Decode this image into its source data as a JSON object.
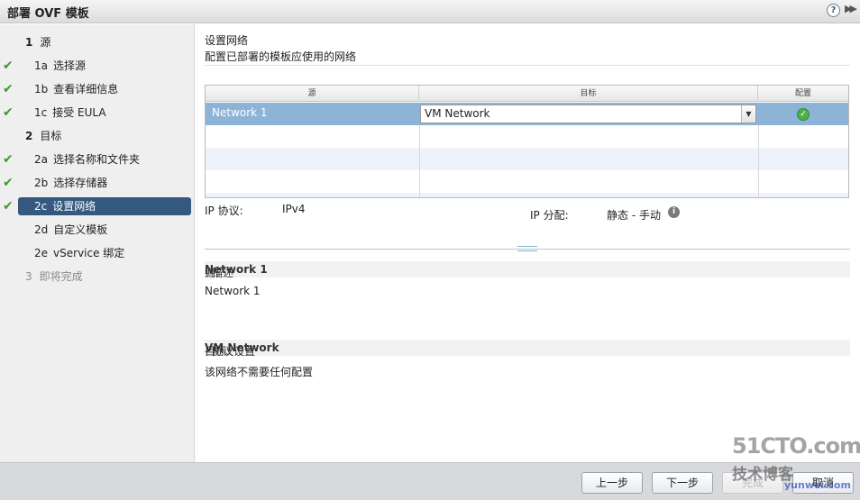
{
  "window": {
    "title": "部署 OVF 模板"
  },
  "nav": {
    "steps": [
      {
        "num": "1",
        "label": "源"
      },
      {
        "num": "1a",
        "label": "选择源"
      },
      {
        "num": "1b",
        "label": "查看详细信息"
      },
      {
        "num": "1c",
        "label": "接受 EULA"
      },
      {
        "num": "2",
        "label": "目标"
      },
      {
        "num": "2a",
        "label": "选择名称和文件夹"
      },
      {
        "num": "2b",
        "label": "选择存储器"
      },
      {
        "num": "2c",
        "label": "设置网络"
      },
      {
        "num": "2d",
        "label": "自定义模板"
      },
      {
        "num": "2e",
        "label": "vService 绑定"
      },
      {
        "num": "3",
        "label": "即将完成"
      }
    ]
  },
  "section": {
    "title": "设置网络",
    "subtitle": "配置已部署的模板应使用的网络"
  },
  "grid": {
    "columns": [
      "源",
      "目标",
      "配置"
    ],
    "rows": [
      {
        "source": "Network 1",
        "destination": "VM Network",
        "configured": true
      }
    ]
  },
  "ip": {
    "protocol_label": "IP 协议:",
    "protocol_value": "IPv4",
    "allocation_label": "IP 分配:",
    "allocation_value": "静态 - 手动"
  },
  "source_desc": {
    "prefix": "源: ",
    "name": "Network 1",
    "suffix": " - 描述",
    "body": "Network 1"
  },
  "dest_desc": {
    "prefix": "目标: ",
    "name": "VM Network",
    "suffix": " - 协议设置",
    "body": "该网络不需要任何配置"
  },
  "footer": {
    "back": "上一步",
    "next": "下一步",
    "finish": "完成",
    "cancel": "取消"
  },
  "watermark": {
    "line1": "51CTO.com",
    "line2": "技术博客",
    "line3": "yunwei.com"
  },
  "colors": {
    "active_step": "#34587f",
    "selected_row": "#8db3d6",
    "check": "#3c9a2c"
  }
}
